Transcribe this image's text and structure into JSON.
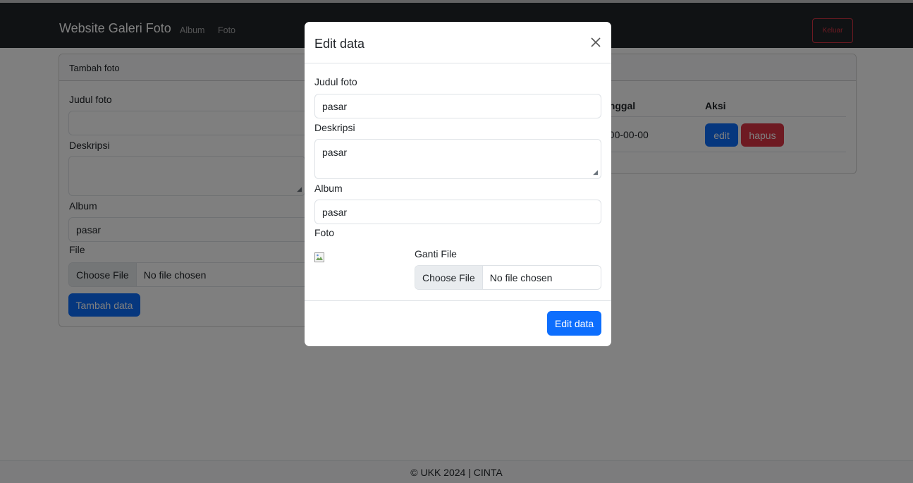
{
  "navbar": {
    "brand": "Website Galeri Foto",
    "links": [
      "Album",
      "Foto"
    ],
    "logout_label": "Keluar"
  },
  "add_form": {
    "title": "Tambah foto",
    "judul_label": "Judul foto",
    "judul_value": "",
    "deskripsi_label": "Deskripsi",
    "deskripsi_value": "",
    "album_label": "Album",
    "album_value": "pasar",
    "file_label": "File",
    "file_button": "Choose File",
    "file_status": "No file chosen",
    "submit_label": "Tambah data"
  },
  "table": {
    "headers": [
      "anggal",
      "Aksi"
    ],
    "rows": [
      {
        "tanggal": "000-00-00",
        "edit_label": "edit",
        "delete_label": "hapus"
      }
    ]
  },
  "modal": {
    "title": "Edit data",
    "judul_label": "Judul foto",
    "judul_value": "pasar",
    "deskripsi_label": "Deskripsi",
    "deskripsi_value": "pasar",
    "album_label": "Album",
    "album_value": "pasar",
    "foto_label": "Foto",
    "ganti_label": "Ganti File",
    "file_button": "Choose File",
    "file_status": "No file chosen",
    "submit_label": "Edit data"
  },
  "footer": {
    "text": "© UKK 2024 | CINTA"
  },
  "colors": {
    "primary": "#0d6efd",
    "danger": "#dc3545",
    "navbar": "#212529",
    "backdrop": "rgba(0,0,0,0.5)"
  }
}
